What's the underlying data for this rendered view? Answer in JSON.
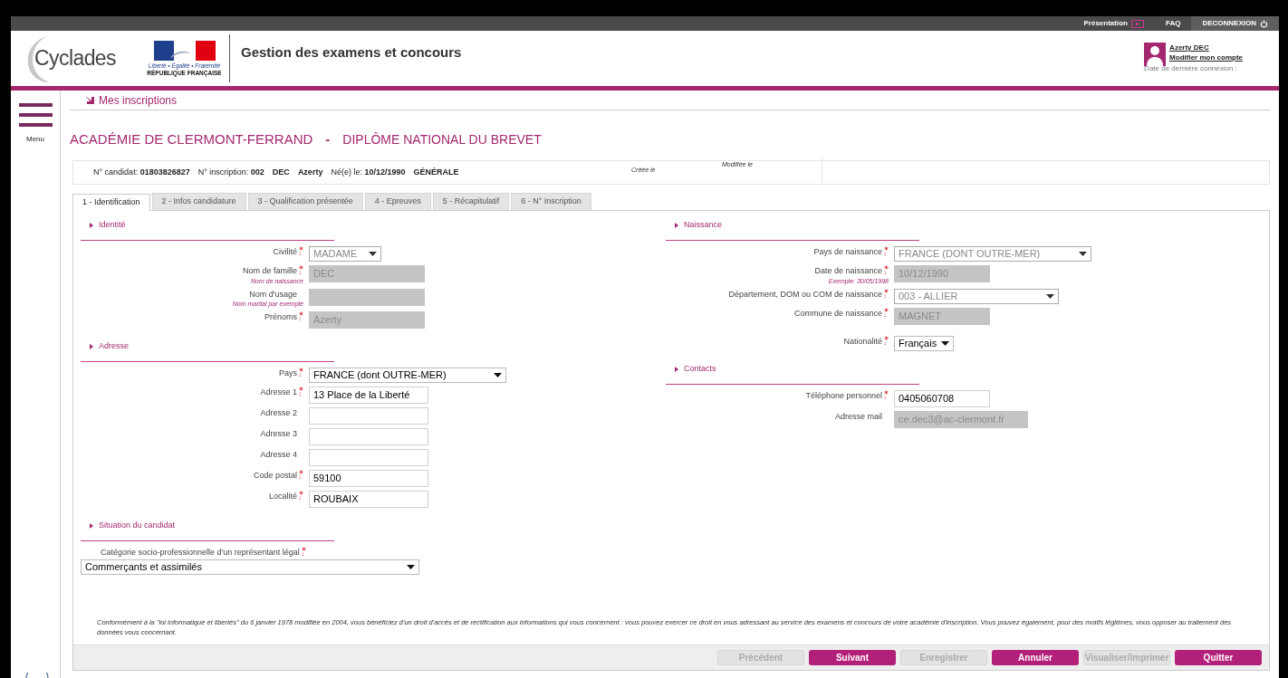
{
  "topbar": {
    "links": [
      {
        "label": "Présentation",
        "kind": "video"
      },
      {
        "label": "FAQ",
        "kind": "plain"
      },
      {
        "label": "DECONNEXION",
        "kind": "logout"
      }
    ]
  },
  "header": {
    "logo": "Cyclades",
    "republic": {
      "motto": "Liberté • Égalité • Fraternité",
      "name": "RÉPUBLIQUE FRANÇAISE"
    },
    "title": "Gestion des examens et concours",
    "user": {
      "name": "Azerty DEC",
      "account_link": "Modifier mon compte",
      "last_login": "Date de dernière connexion :"
    }
  },
  "sidebar": {
    "menu_label": "Menu"
  },
  "breadcrumb": "Mes inscriptions",
  "page_title": {
    "academy": "ACADÉMIE DE CLERMONT-FERRAND",
    "separator": "-",
    "exam": "DIPLÔME NATIONAL DU BREVET"
  },
  "candidate_info": {
    "items": [
      {
        "label": "N° candidat:",
        "value": "01803826827"
      },
      {
        "label": "N° inscription:",
        "value": "002"
      },
      {
        "value": "DEC"
      },
      {
        "value": "Azerty"
      },
      {
        "label": "Né(e) le:",
        "value": "10/12/1990"
      },
      {
        "value": "GÉNÉRALE"
      }
    ],
    "created": "Créée le",
    "modified": "Modifiée le"
  },
  "tabs": [
    {
      "label": "1 - Identification",
      "selected": true
    },
    {
      "label": "2 - Infos candidature",
      "selected": false
    },
    {
      "label": "3 - Qualification présentée",
      "selected": false
    },
    {
      "label": "4 - Epreuves",
      "selected": false
    },
    {
      "label": "5 - Récapitulatif",
      "selected": false
    },
    {
      "label": "6 - N° Inscription",
      "selected": false
    }
  ],
  "left_column": [
    {
      "title": "Identité",
      "kind": "inline",
      "fields": [
        {
          "label": "Civilité",
          "required": true,
          "kind": "select",
          "value": "MADAME",
          "disabled": true
        },
        {
          "label": "Nom de famille",
          "hint": "Nom de naissance",
          "required": true,
          "kind": "input",
          "value": "DEC",
          "disabled": true
        },
        {
          "label": "Nom d'usage",
          "hint": "Nom marital par exemple",
          "required": false,
          "kind": "input",
          "disabled": true
        },
        {
          "label": "Prénoms",
          "required": true,
          "kind": "input",
          "value": "Azerty",
          "disabled": true
        }
      ]
    },
    {
      "title": "Adresse",
      "kind": "inline",
      "fields": [
        {
          "label": "Pays",
          "required": true,
          "kind": "select",
          "value": "FRANCE (dont OUTRE-MER)",
          "disabled": false
        },
        {
          "label": "Adresse 1",
          "required": true,
          "kind": "input",
          "value": "13 Place de la Liberté",
          "disabled": false
        },
        {
          "label": "Adresse 2",
          "required": false,
          "kind": "input",
          "disabled": false
        },
        {
          "label": "Adresse 3",
          "required": false,
          "kind": "input",
          "disabled": false
        },
        {
          "label": "Adresse 4",
          "required": false,
          "kind": "input",
          "disabled": false
        },
        {
          "label": "Code postal",
          "required": true,
          "kind": "input",
          "value": "59100",
          "disabled": false
        },
        {
          "label": "Localité",
          "required": true,
          "kind": "input",
          "value": "ROUBAIX",
          "disabled": false
        }
      ]
    },
    {
      "title": "Situation du candidat",
      "kind": "stacked",
      "fields": [
        {
          "label": "Catégorie socio-professionnelle d'un représentant légal",
          "required": true,
          "kind": "select",
          "value": "Commerçants et assimilés",
          "disabled": false
        }
      ]
    }
  ],
  "right_column": [
    {
      "title": "Naissance",
      "kind": "inline",
      "fields": [
        {
          "label": "Pays de naissance",
          "required": true,
          "kind": "select",
          "value": "FRANCE (DONT OUTRE-MER)",
          "disabled": true
        },
        {
          "label": "Date de naissance",
          "hint": "Exemple: 30/05/1998",
          "required": true,
          "kind": "input",
          "value": "10/12/1990",
          "disabled": true
        },
        {
          "label": "Département, DOM ou COM de naissance",
          "required": true,
          "kind": "select",
          "value": "003 - ALLIER",
          "disabled": true
        },
        {
          "label": "Commune de naissance",
          "required": true,
          "kind": "input",
          "value": "MAGNET",
          "disabled": true
        },
        {
          "label": "Nationalité",
          "required": true,
          "kind": "select",
          "value": "Français",
          "disabled": false
        }
      ]
    },
    {
      "title": "Contacts",
      "kind": "inline",
      "fields": [
        {
          "label": "Téléphone personnel",
          "required": true,
          "kind": "input",
          "value": "0405060708",
          "disabled": false
        },
        {
          "label": "Adresse mail",
          "required": false,
          "kind": "input",
          "value": "ce.dec3@ac-clermont.fr",
          "disabled": true
        }
      ]
    }
  ],
  "legal_notice": "Conformément à la \"loi informatique et libertés\" du 6 janvier 1978 modifiée en 2004, vous bénéficiez d'un droit d'accès et de rectification aux informations qui vous concernent : vous pouvez exercer ce droit en vous adressant au service des examens et concours de votre académie d'inscription. Vous pouvez également, pour des motifs légitimes, vous opposer au traitement des données vous concernant.",
  "buttons": [
    {
      "label": "Précédent",
      "disabled": true
    },
    {
      "label": "Suivant",
      "disabled": false
    },
    {
      "label": "Enregistrer",
      "disabled": true
    },
    {
      "label": "Annuler",
      "disabled": false
    },
    {
      "label": "Visualiser/imprimer",
      "disabled": true
    },
    {
      "label": "Quitter",
      "disabled": false
    }
  ]
}
